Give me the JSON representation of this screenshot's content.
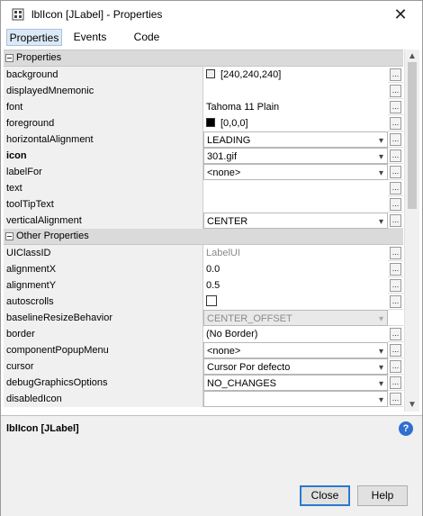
{
  "window": {
    "title": "lblIcon [JLabel] - Properties"
  },
  "tabs": [
    {
      "label": "Properties"
    },
    {
      "label": "Events"
    },
    {
      "label": "Code"
    }
  ],
  "categories": {
    "properties": "Properties",
    "other": "Other Properties"
  },
  "rows": [
    {
      "name": "background",
      "value": "[240,240,240]"
    },
    {
      "name": "displayedMnemonic",
      "value": ""
    },
    {
      "name": "font",
      "value": "Tahoma 11 Plain"
    },
    {
      "name": "foreground",
      "value": "[0,0,0]"
    },
    {
      "name": "horizontalAlignment",
      "value": "LEADING"
    },
    {
      "name": "icon",
      "value": "301.gif"
    },
    {
      "name": "labelFor",
      "value": "<none>"
    },
    {
      "name": "text",
      "value": ""
    },
    {
      "name": "toolTipText",
      "value": ""
    },
    {
      "name": "verticalAlignment",
      "value": "CENTER"
    },
    {
      "name": "UIClassID",
      "value": "LabelUI"
    },
    {
      "name": "alignmentX",
      "value": "0.0"
    },
    {
      "name": "alignmentY",
      "value": "0.5"
    },
    {
      "name": "autoscrolls",
      "value": ""
    },
    {
      "name": "baselineResizeBehavior",
      "value": "CENTER_OFFSET"
    },
    {
      "name": "border",
      "value": "(No Border)"
    },
    {
      "name": "componentPopupMenu",
      "value": "<none>"
    },
    {
      "name": "cursor",
      "value": "Cursor Por defecto"
    },
    {
      "name": "debugGraphicsOptions",
      "value": "NO_CHANGES"
    },
    {
      "name": "disabledIcon",
      "value": ""
    }
  ],
  "ellipsis": "...",
  "description": {
    "title": "lblIcon [JLabel]",
    "help": "?"
  },
  "buttons": {
    "close": "Close",
    "help": "Help"
  },
  "colors": {
    "background_swatch": "#f0f0f0",
    "foreground_swatch": "#000000",
    "accent": "#2b78d0",
    "tab_active": "#dbe9f6"
  }
}
